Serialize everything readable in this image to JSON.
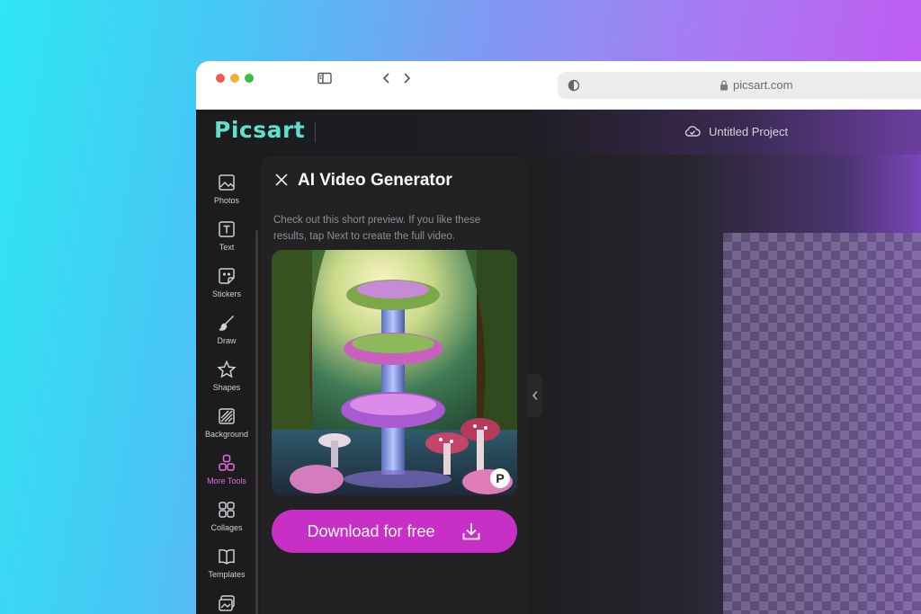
{
  "browser": {
    "url": "picsart.com"
  },
  "app": {
    "logo": "Picsart",
    "project_name": "Untitled Project",
    "accent_color": "#c82fc6",
    "logo_color": "#5fe0cf"
  },
  "tools": [
    {
      "label": "Photos",
      "icon": "image-icon"
    },
    {
      "label": "Text",
      "icon": "text-icon"
    },
    {
      "label": "Stickers",
      "icon": "sticker-icon"
    },
    {
      "label": "Draw",
      "icon": "brush-icon"
    },
    {
      "label": "Shapes",
      "icon": "star-icon"
    },
    {
      "label": "Background",
      "icon": "background-icon"
    },
    {
      "label": "More Tools",
      "icon": "more-tools-icon",
      "active": true
    },
    {
      "label": "Collages",
      "icon": "collage-icon"
    },
    {
      "label": "Templates",
      "icon": "book-icon"
    }
  ],
  "panel": {
    "title": "AI Video Generator",
    "description": "Check out this short preview. If you like these results, tap Next to create the full video.",
    "preview_badge": "P",
    "download_label": "Download for free"
  }
}
